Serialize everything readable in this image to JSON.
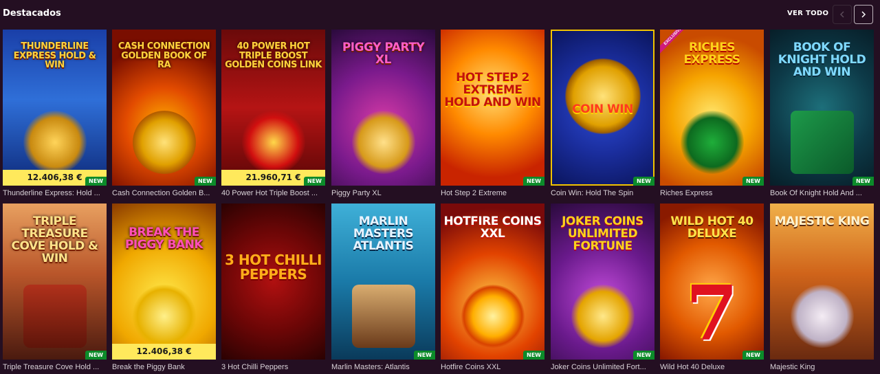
{
  "header": {
    "title": "Destacados",
    "see_all": "VER TODO"
  },
  "badges": {
    "new": "NEW",
    "exclusive": "EXCLUSIVE"
  },
  "games": [
    {
      "name": "Thunderline Express: Hold ...",
      "art_title": "THUNDERLINE EXPRESS HOLD & WIN",
      "jackpot": "12.406,38 €",
      "is_new": true
    },
    {
      "name": "Cash Connection Golden B...",
      "art_title": "CASH CONNECTION GOLDEN BOOK OF RA",
      "is_new": true
    },
    {
      "name": "40 Power Hot Triple Boost ...",
      "art_title": "40 POWER HOT TRIPLE BOOST GOLDEN COINS LINK",
      "jackpot": "21.960,71 €",
      "is_new": true
    },
    {
      "name": "Piggy Party XL",
      "art_title": "PIGGY PARTY XL",
      "is_new": false
    },
    {
      "name": "Hot Step 2 Extreme",
      "art_title": "HOT STEP 2 EXTREME HOLD AND WIN",
      "is_new": true
    },
    {
      "name": "Coin Win: Hold The Spin",
      "art_title": "COIN WIN",
      "is_new": true
    },
    {
      "name": "Riches Express",
      "art_title": "RICHES EXPRESS",
      "is_new": true
    },
    {
      "name": "Book Of Knight Hold And ...",
      "art_title": "BOOK OF KNIGHT HOLD AND WIN",
      "is_new": true
    },
    {
      "name": "Triple Treasure Cove Hold ...",
      "art_title": "TRIPLE TREASURE COVE HOLD & WIN",
      "is_new": true
    },
    {
      "name": "Break the Piggy Bank",
      "art_title": "BREAK THE PIGGY BANK",
      "jackpot": "12.406,38 €",
      "is_new": false
    },
    {
      "name": "3 Hot Chilli Peppers",
      "art_title": "3 HOT CHILLI PEPPERS",
      "is_new": false
    },
    {
      "name": "Marlin Masters: Atlantis",
      "art_title": "MARLIN MASTERS ATLANTIS",
      "is_new": true
    },
    {
      "name": "Hotfire Coins XXL",
      "art_title": "HOTFIRE COINS XXL",
      "is_new": true
    },
    {
      "name": "Joker Coins Unlimited Fort...",
      "art_title": "JOKER COINS UNLIMITED FORTUNE",
      "is_new": true
    },
    {
      "name": "Wild Hot 40 Deluxe",
      "art_title": "WILD HOT 40 DELUXE",
      "is_new": true
    },
    {
      "name": "Majestic King",
      "art_title": "MAJESTIC KING",
      "is_new": false
    }
  ]
}
